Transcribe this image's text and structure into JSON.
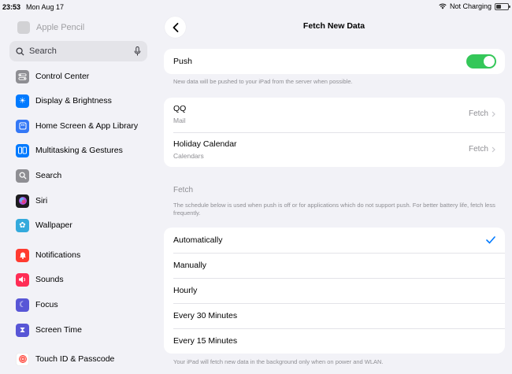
{
  "status_bar": {
    "time": "23:53",
    "date": "Mon Aug 17",
    "charging": "Not Charging"
  },
  "sidebar": {
    "faded_item": "Apple Pencil",
    "search_placeholder": "Search",
    "items": [
      {
        "label": "Control Center",
        "icon": "switches-icon",
        "color": "#8e8e93"
      },
      {
        "label": "Display & Brightness",
        "icon": "sun-icon",
        "color": "#007aff"
      },
      {
        "label": "Home Screen & App Library",
        "icon": "home-grid-icon",
        "color": "#3478f6"
      },
      {
        "label": "Multitasking & Gestures",
        "icon": "windows-icon",
        "color": "#007aff"
      },
      {
        "label": "Search",
        "icon": "magnifier-icon",
        "color": "#8e8e93"
      },
      {
        "label": "Siri",
        "icon": "siri-icon",
        "color": "#1c1c1e"
      },
      {
        "label": "Wallpaper",
        "icon": "flower-icon",
        "color": "#34aadc"
      },
      {
        "label": "Notifications",
        "icon": "bell-icon",
        "color": "#ff3b30"
      },
      {
        "label": "Sounds",
        "icon": "speaker-icon",
        "color": "#ff2d55"
      },
      {
        "label": "Focus",
        "icon": "moon-icon",
        "color": "#5856d6"
      },
      {
        "label": "Screen Time",
        "icon": "hourglass-icon",
        "color": "#5856d6"
      },
      {
        "label": "Touch ID & Passcode",
        "icon": "fingerprint-icon",
        "color": "#ff3b30"
      }
    ]
  },
  "main": {
    "title": "Fetch New Data",
    "push": {
      "label": "Push",
      "enabled": true,
      "note": "New data will be pushed to your iPad from the server when possible."
    },
    "accounts": [
      {
        "name": "QQ",
        "type": "Mail",
        "mode": "Fetch"
      },
      {
        "name": "Holiday Calendar",
        "type": "Calendars",
        "mode": "Fetch"
      }
    ],
    "fetch_header": "Fetch",
    "fetch_note": "The schedule below is used when push is off or for applications which do not support push. For better battery life, fetch less frequently.",
    "options": [
      "Automatically",
      "Manually",
      "Hourly",
      "Every 30 Minutes",
      "Every 15 Minutes"
    ],
    "selected": "Automatically",
    "bottom_note": "Your iPad will fetch new data in the background only when on power and WLAN.",
    "accent": "#007aff",
    "toggle_color": "#34c759"
  }
}
